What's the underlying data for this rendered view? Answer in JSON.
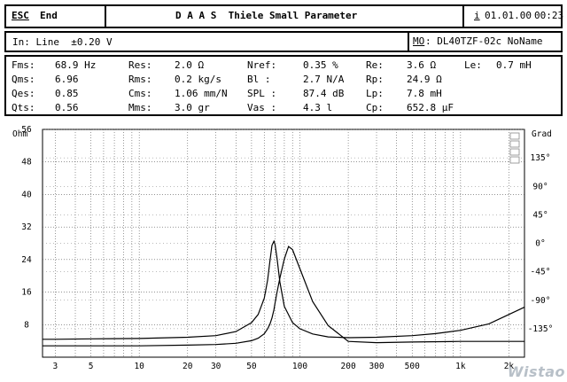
{
  "titlebar": {
    "esc_key": "ESC",
    "end_label": "End",
    "app_title": "D A A S  Thiele Small Parameter",
    "info_key": "i",
    "date": "01.01.00",
    "time": "00:23"
  },
  "inputbar": {
    "input_text": "In: Line  ±0.20 V",
    "model_key": "MO",
    "model_text": ": DL40TZF-02c NoName"
  },
  "params": [
    [
      {
        "label": "Fms:",
        "value": "68.9 Hz"
      },
      {
        "label": "Res:",
        "value": "2.0 Ω"
      },
      {
        "label": "Nref:",
        "value": "0.35 %"
      },
      {
        "label": "Re:",
        "value": "3.6 Ω"
      },
      {
        "label": "Le:",
        "value": "0.7 mH"
      }
    ],
    [
      {
        "label": "Qms:",
        "value": "6.96"
      },
      {
        "label": "Rms:",
        "value": "0.2 kg/s"
      },
      {
        "label": "Bl :",
        "value": "2.7 N/A"
      },
      {
        "label": "Rp:",
        "value": "24.9 Ω"
      }
    ],
    [
      {
        "label": "Qes:",
        "value": "0.85"
      },
      {
        "label": "Cms:",
        "value": "1.06 mm/N"
      },
      {
        "label": "SPL :",
        "value": "87.4 dB"
      },
      {
        "label": "Lp:",
        "value": "7.8 mH"
      }
    ],
    [
      {
        "label": "Qts:",
        "value": "0.56"
      },
      {
        "label": "Mms:",
        "value": "3.0 gr"
      },
      {
        "label": "Vas :",
        "value": "4.3 l"
      },
      {
        "label": "Cp:",
        "value": "652.8 µF"
      }
    ]
  ],
  "chart_data": {
    "type": "line",
    "xscale": "log",
    "xlim": [
      2.5,
      2500
    ],
    "xticks": [
      {
        "v": 3,
        "t": "3"
      },
      {
        "v": 5,
        "t": "5"
      },
      {
        "v": 10,
        "t": "10"
      },
      {
        "v": 20,
        "t": "20"
      },
      {
        "v": 30,
        "t": "30"
      },
      {
        "v": 50,
        "t": "50"
      },
      {
        "v": 100,
        "t": "100"
      },
      {
        "v": 200,
        "t": "200"
      },
      {
        "v": 300,
        "t": "300"
      },
      {
        "v": 500,
        "t": "500"
      },
      {
        "v": 1000,
        "t": "1k"
      },
      {
        "v": 2000,
        "t": "2k"
      }
    ],
    "yleft_label": "Ohm",
    "yleft_lim": [
      0,
      56
    ],
    "yleft_ticks": [
      "8",
      "16",
      "24",
      "32",
      "40",
      "48",
      "56"
    ],
    "yright_label": "Grad",
    "yright_lim": [
      -180,
      180
    ],
    "yright_ticks": [
      {
        "v": 135,
        "t": "135°"
      },
      {
        "v": 90,
        "t": "90°"
      },
      {
        "v": 45,
        "t": "45°"
      },
      {
        "v": 0,
        "t": "0°"
      },
      {
        "v": -45,
        "t": "-45°"
      },
      {
        "v": -90,
        "t": "-90°"
      },
      {
        "v": -135,
        "t": "-135°"
      }
    ],
    "grid": true,
    "series": [
      {
        "key": "impedance",
        "axis": "left",
        "x": [
          2.5,
          3,
          5,
          10,
          20,
          30,
          40,
          50,
          55,
          60,
          63,
          65,
          67,
          68.9,
          70,
          72,
          75,
          80,
          90,
          100,
          120,
          150,
          200,
          300,
          500,
          700,
          1000,
          1500,
          2000,
          2500
        ],
        "y": [
          4.4,
          4.4,
          4.5,
          4.6,
          4.9,
          5.3,
          6.3,
          8.5,
          10.5,
          14.5,
          19,
          23.5,
          27.5,
          28.5,
          27.8,
          24.5,
          18.5,
          12.5,
          8.5,
          7,
          5.7,
          5,
          4.8,
          4.9,
          5.3,
          5.8,
          6.6,
          8.2,
          10.5,
          12.3
        ]
      },
      {
        "key": "phase",
        "axis": "right",
        "x": [
          2.5,
          3,
          5,
          10,
          20,
          30,
          40,
          50,
          55,
          60,
          63,
          65,
          67,
          68.9,
          70,
          72,
          75,
          80,
          85,
          90,
          100,
          120,
          150,
          200,
          300,
          500,
          1000,
          2500
        ],
        "y": [
          -162,
          -162,
          -162,
          -162,
          -161,
          -160,
          -158,
          -154,
          -150,
          -143,
          -135,
          -128,
          -118,
          -105,
          -95,
          -78,
          -55,
          -25,
          -5,
          -10,
          -40,
          -92,
          -130,
          -155,
          -157,
          -156,
          -155,
          -155
        ]
      }
    ]
  },
  "watermark": "Wistao"
}
